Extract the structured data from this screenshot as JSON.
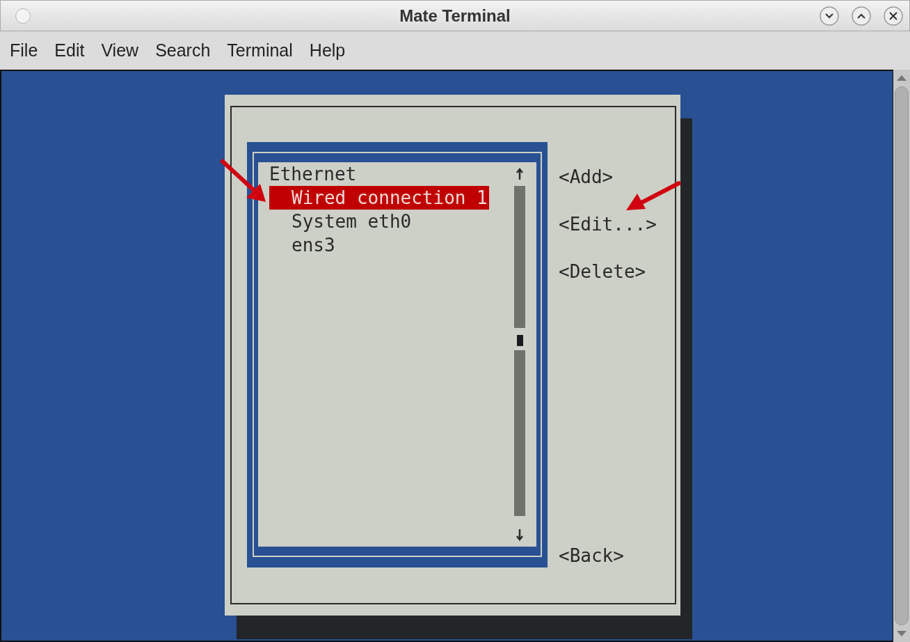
{
  "window": {
    "title": "Mate Terminal"
  },
  "menu": [
    "File",
    "Edit",
    "View",
    "Search",
    "Terminal",
    "Help"
  ],
  "connection_list": {
    "groups": [
      {
        "label": "Ethernet",
        "children": [
          {
            "label": "Wired connection 1",
            "selected": true
          },
          {
            "label": "System eth0",
            "selected": false
          },
          {
            "label": "ens3",
            "selected": false
          }
        ]
      }
    ]
  },
  "buttons": [
    "<Add>",
    "<Edit...>",
    "<Delete>",
    "<Back>"
  ]
}
